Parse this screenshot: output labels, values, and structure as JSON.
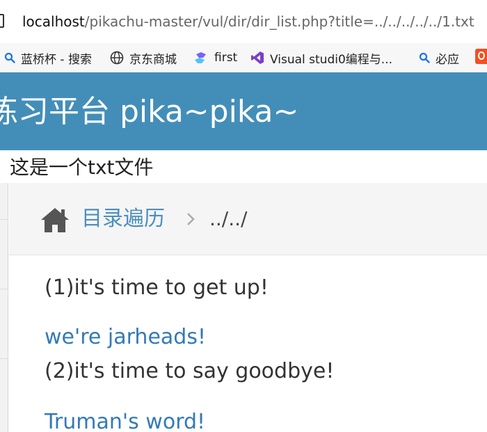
{
  "browser": {
    "url_host": "localhost",
    "url_path": "/pikachu-master/vul/dir/dir_list.php?title=../../../../../1.txt",
    "bookmarks": [
      {
        "label": "蓝桥杯 - 搜索",
        "icon": "search-icon"
      },
      {
        "label": "京东商城",
        "icon": "globe-icon"
      },
      {
        "label": "first",
        "icon": "cloud-icon"
      },
      {
        "label": "Visual studi0编程与...",
        "icon": "visual-studio-icon"
      },
      {
        "label": "必应",
        "icon": "search-icon"
      }
    ]
  },
  "header": {
    "title": "练习平台 pika~pika~"
  },
  "file_content": "这是一个txt文件",
  "breadcrumb": {
    "link": "目录遍历",
    "current": "../../"
  },
  "content": {
    "lines": [
      {
        "text": "(1)it's time to get up!",
        "kind": "text"
      },
      {
        "text": "we're jarheads!",
        "kind": "link"
      },
      {
        "text": "(2)it's time to say goodbye!",
        "kind": "text"
      },
      {
        "text": "Truman's word!",
        "kind": "link"
      }
    ]
  },
  "colors": {
    "header_bg": "#438eb9",
    "link": "#337ab7",
    "breadcrumb_link": "#4c8fbd",
    "bing_orange": "#f25022"
  }
}
